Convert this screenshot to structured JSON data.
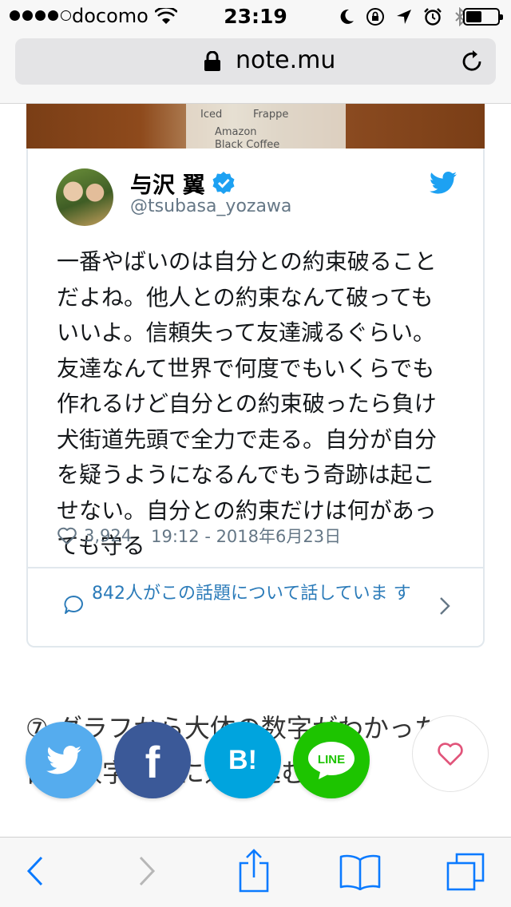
{
  "status_bar": {
    "carrier": "docomo",
    "time": "23:19",
    "signal_bars": 4,
    "battery_level": 0.5
  },
  "browser": {
    "url": "note.mu"
  },
  "photo_text": {
    "iced": "Iced",
    "frappe": "Frappe",
    "amazon": "Amazon",
    "black_coffee": "Black Coffee"
  },
  "tweet": {
    "author_name": "与沢 翼",
    "handle": "@tsubasa_yozawa",
    "lines": [
      "一番やばいのは自分との約束破ること",
      "だよね。他人との約束なんて破っても",
      "いいよ。信頼失って友達減るぐらい。",
      "友達なんて世界で何度でもいくらでも",
      "作れるけど自分との約束破ったら負け",
      "犬街道先頭で全力で走る。自分が自分",
      "を疑うようになるんでもう奇跡は起こ",
      "せない。自分との約束だけは何があっ",
      "ても守る"
    ],
    "likes": "3,924",
    "timestamp": "19:12 - 2018年6月23日",
    "talk_link": "842人がこの話題について話していま す"
  },
  "article": {
    "heading": "⑦ グラフから大体の数字がわかった ら目標数字で更に追い込む"
  },
  "share": {
    "hatena_label": "B!",
    "facebook_label": "f",
    "line_label": "LINE"
  },
  "colors": {
    "twitter_blue": "#55acee",
    "facebook_blue": "#3b5998",
    "hatena_blue": "#00a4de",
    "line_green": "#1dc400",
    "ios_blue": "#0a7aff",
    "like_pink": "#e1547a"
  },
  "icons": [
    "wifi-icon",
    "moon-icon",
    "rotation-lock-icon",
    "location-icon",
    "alarm-icon",
    "bluetooth-icon",
    "lock-icon",
    "reload-icon",
    "verified-icon",
    "twitter-bird-icon",
    "heart-outline-icon",
    "comment-icon",
    "chevron-right-icon",
    "back-icon",
    "forward-icon",
    "share-icon",
    "bookmarks-icon",
    "tabs-icon"
  ]
}
